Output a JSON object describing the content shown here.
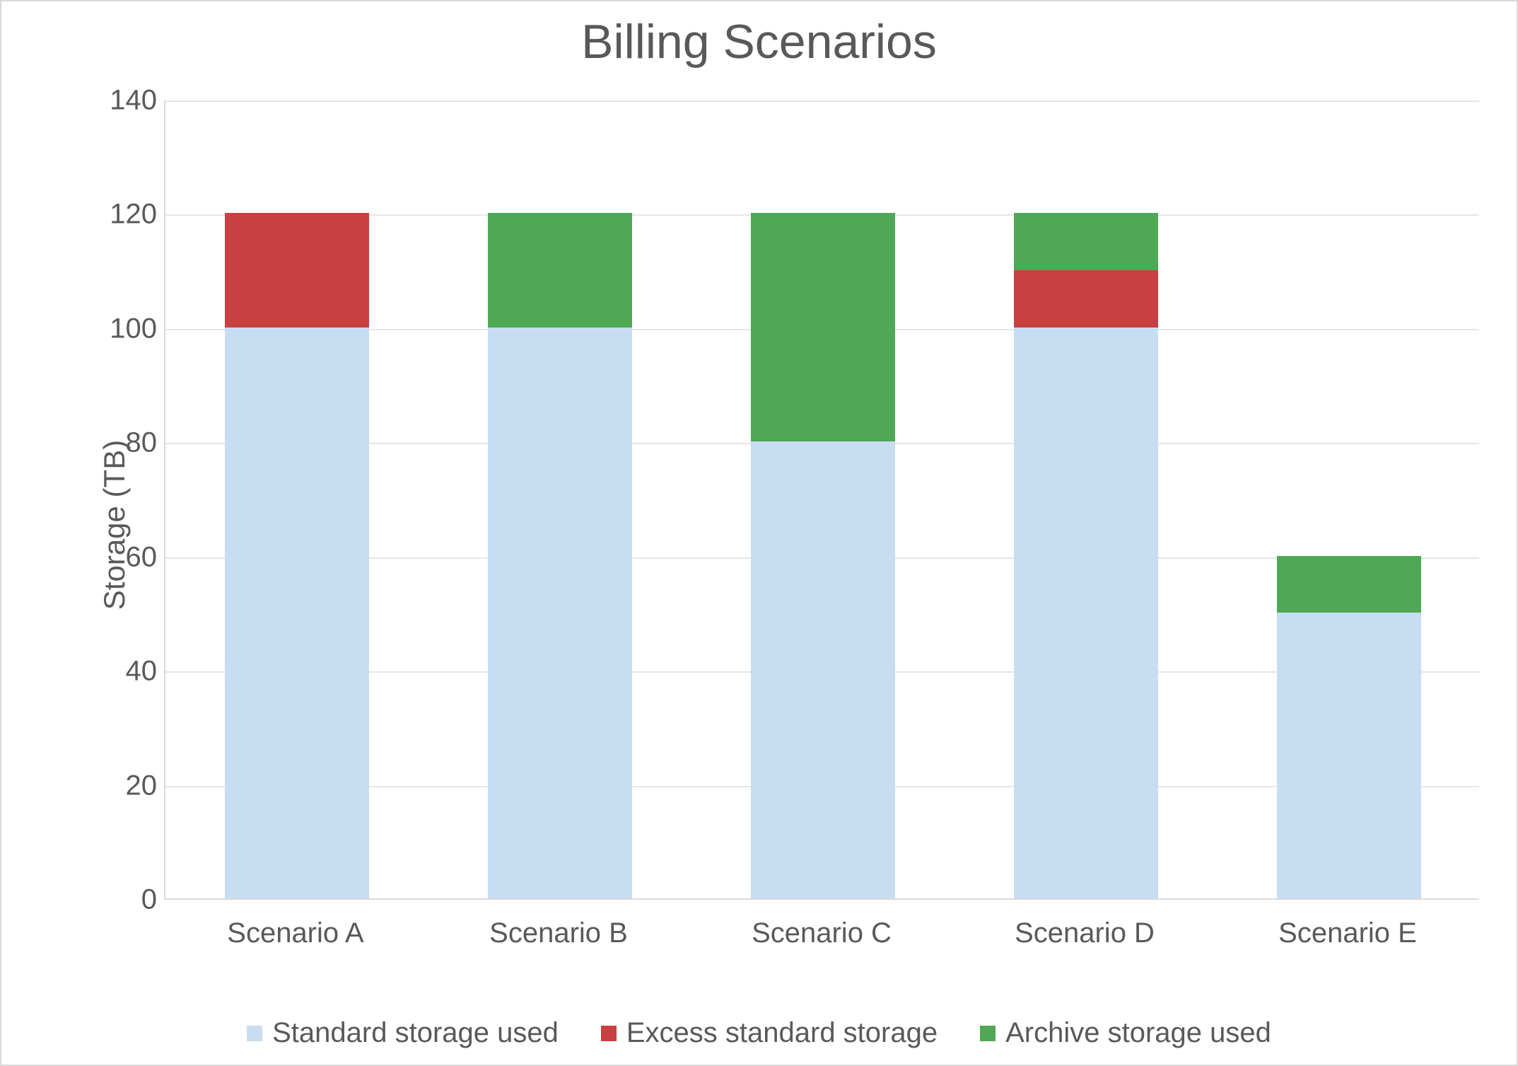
{
  "chart_data": {
    "type": "bar",
    "title": "Billing Scenarios",
    "xlabel": "",
    "ylabel": "Storage (TB)",
    "ylim": [
      0,
      140
    ],
    "ytick_step": 20,
    "categories": [
      "Scenario A",
      "Scenario B",
      "Scenario C",
      "Scenario D",
      "Scenario E"
    ],
    "series": [
      {
        "name": "Standard storage used",
        "color": "#c7ddf2",
        "values": [
          100,
          100,
          80,
          100,
          50
        ]
      },
      {
        "name": "Excess standard storage",
        "color": "#c94041",
        "values": [
          20,
          0,
          0,
          10,
          0
        ]
      },
      {
        "name": "Archive storage used",
        "color": "#4ea855",
        "values": [
          0,
          20,
          40,
          10,
          10
        ]
      }
    ],
    "legend_position": "bottom",
    "grid": true
  }
}
